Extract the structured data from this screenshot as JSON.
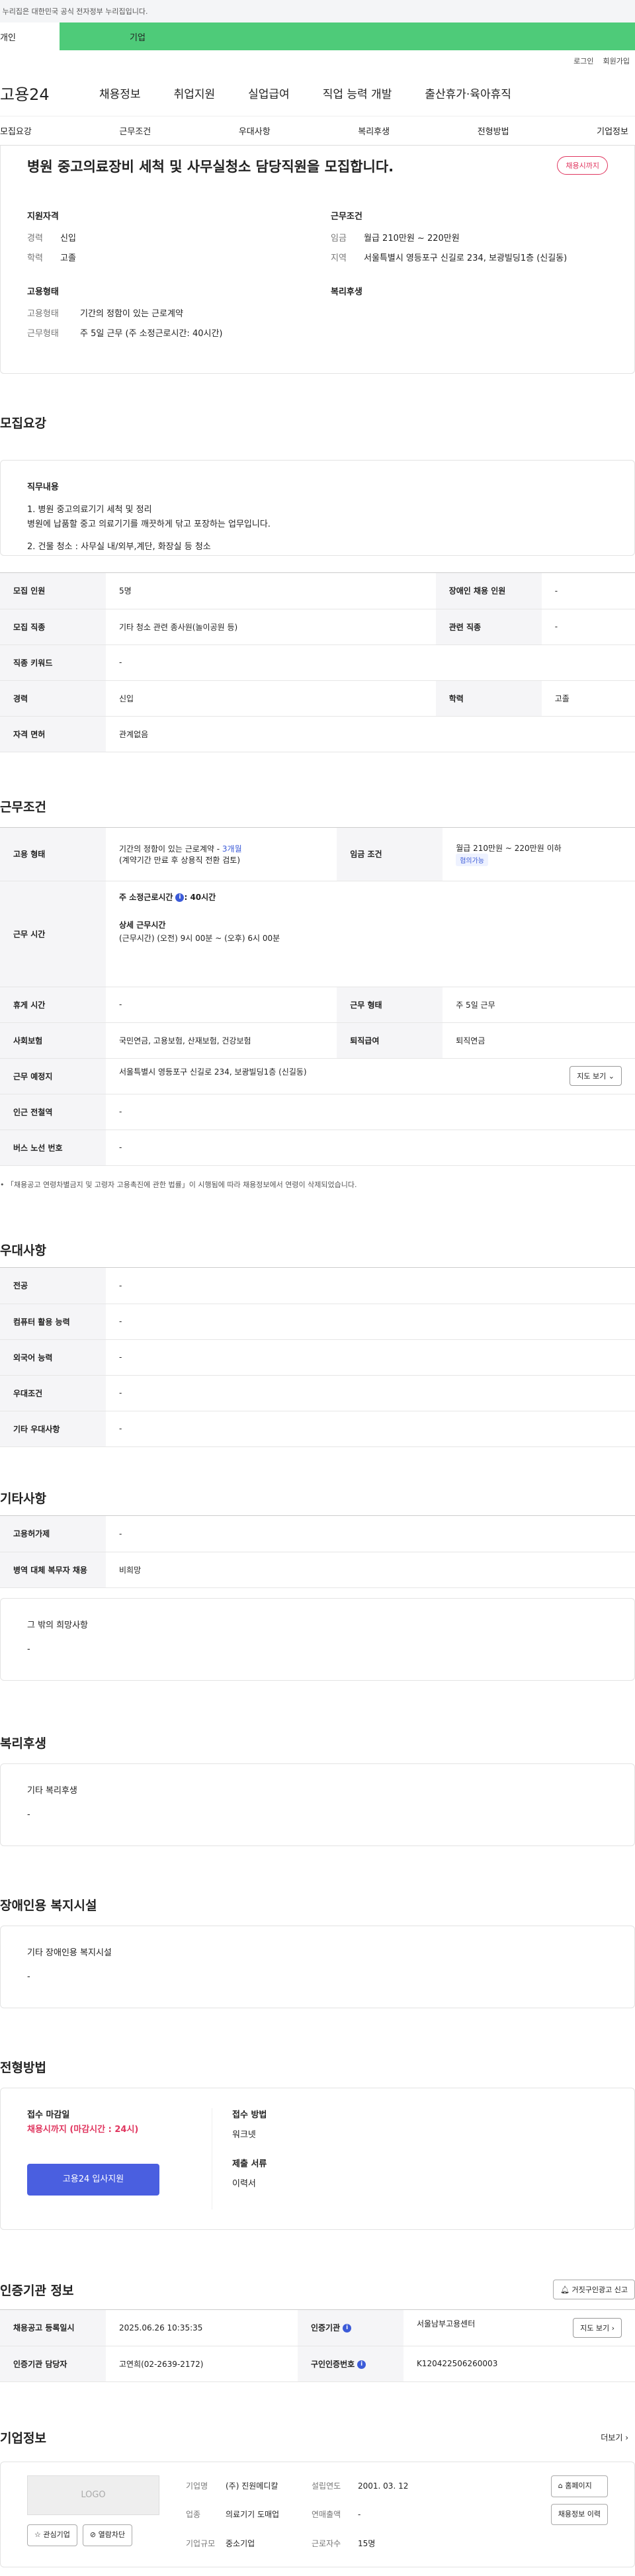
{
  "top": {
    "note": "이 누리집은 대한민국 공식 전자정부 누리집입니다.",
    "tab_personal": "개인",
    "tab_company": "기업",
    "login": "로그인",
    "signup": "회원가입"
  },
  "gnb": {
    "logo": "고용24",
    "items": [
      "채용정보",
      "취업지원",
      "실업급여",
      "직업 능력 개발",
      "출산휴가·육아휴직"
    ]
  },
  "subtabs": [
    "모집요강",
    "근무조건",
    "우대사항",
    "복리후생",
    "전형방법",
    "기업정보"
  ],
  "summary": {
    "title": "병원 중고의료장비 세척 및 사무실청소 담당직원을 모집합니다.",
    "badge": "채용시까지",
    "qual_heading": "지원자격",
    "career_k": "경력",
    "career_v": "신입",
    "edu_k": "학력",
    "edu_v": "고졸",
    "cond_heading": "근무조건",
    "wage_k": "임금",
    "wage_v": "월급 210만원 ~ 220만원",
    "area_k": "지역",
    "area_v": "서울특별시 영등포구 신길로 234, 보광빌딩1층 (신길동)",
    "emp_heading": "고용형태",
    "emptype_k": "고용형태",
    "emptype_v": "기간의 정함이 있는 근로계약",
    "worktype_k": "근무형태",
    "worktype_v": "주 5일 근무 (주 소정근로시간: 40시간)",
    "welfare_heading": "복리후생"
  },
  "recruit": {
    "title": "모집요강",
    "duty_heading": "직무내용",
    "duty_lines": [
      "1. 병원 중고의료기기 세척 및 정리",
      "병원에 납품할 중고 의료기기를 깨끗하게 닦고 포장하는 업무입니다.",
      "2. 건물 청소 : 사무실 내/외부,계단, 화장실 등 청소"
    ],
    "rows": [
      {
        "k1": "모집 인원",
        "v1": "5명",
        "k2": "장애인 채용 인원",
        "v2": "-"
      },
      {
        "k1": "모집 직종",
        "v1": "기타 청소 관련 종사원(놀이공원 등)",
        "k2": "관련 직종",
        "v2": "-"
      },
      {
        "k1": "직종 키워드",
        "v1": "-"
      },
      {
        "k1": "경력",
        "v1": "신입",
        "k2": "학력",
        "v2": "고졸"
      },
      {
        "k1": "자격 면허",
        "v1": "관계없음"
      }
    ]
  },
  "work": {
    "title": "근무조건",
    "emp_k": "고용 형태",
    "emp_v1": "기간의 정함이 있는 근로계약 - ",
    "emp_v1_link": "3개월",
    "emp_v2": "(계약기간 만료 후 상용직 전환 검토)",
    "wage_k": "임금 조건",
    "wage_v": "월급 210만원 ~ 220만원 이하",
    "wage_pill": "협의가능",
    "hours_k": "근무 시간",
    "hours_weekly": "주 소정근로시간",
    "hours_weekly_v": ": 40시간",
    "hours_detail_h": "상세 근무시간",
    "hours_detail_v": "(근무시간) (오전) 9시 00분 ~ (오후) 6시 00분",
    "rows": [
      {
        "k1": "휴게 시간",
        "v1": "-",
        "k2": "근무 형태",
        "v2": "주 5일 근무"
      },
      {
        "k1": "사회보험",
        "v1": "국민연금, 고용보험, 산재보험, 건강보험",
        "k2": "퇴직급여",
        "v2": "퇴직연금"
      }
    ],
    "place_k": "근무 예정지",
    "place_v": "서울특별시 영등포구 신길로 234, 보광빌딩1층 (신길동)",
    "map_btn": "지도 보기",
    "station_k": "인근 전철역",
    "station_v": "-",
    "bus_k": "버스 노선 번호",
    "bus_v": "-",
    "note": "「채용공고 연령차별금지 및 고령자 고용촉진에 관한 법률」이 시행됨에 따라 채용정보에서 연령이 삭제되었습니다."
  },
  "pref": {
    "title": "우대사항",
    "rows": [
      {
        "k": "전공",
        "v": "-"
      },
      {
        "k": "컴퓨터 활용 능력",
        "v": "-"
      },
      {
        "k": "외국어 능력",
        "v": "-"
      },
      {
        "k": "우대조건",
        "v": "-"
      },
      {
        "k": "기타 우대사항",
        "v": "-"
      }
    ]
  },
  "etc": {
    "title": "기타사항",
    "rows": [
      {
        "k": "고용허가제",
        "v": "-"
      },
      {
        "k": "병역 대체 복무자 채용",
        "v": "비희망"
      }
    ],
    "hope_h": "그 밖의 희망사항",
    "hope_v": "-"
  },
  "welfare": {
    "title": "복리후생",
    "h": "기타 복리후생",
    "v": "-"
  },
  "disab": {
    "title": "장애인용 복지시설",
    "h": "기타 장애인용 복지시설",
    "v": "-"
  },
  "selection": {
    "title": "전형방법",
    "deadline_h": "접수 마감일",
    "deadline_v": "채용시까지 (마감시간 : 24시)",
    "apply_btn": "고용24 입사지원",
    "method_h": "접수 방법",
    "method_v": "워크넷",
    "docs_h": "제출 서류",
    "docs_v": "이력서"
  },
  "cert": {
    "title": "인증기관 정보",
    "report_btn": "거짓구인광고 신고",
    "reg_k": "채용공고 등록일시",
    "reg_v": "2025.06.26 10:35:35",
    "org_k": "인증기관",
    "org_v": "서울남부고용센터",
    "map_btn": "지도 보기",
    "mgr_k": "인증기관 담당자",
    "mgr_v": "고연희(02-2639-2172)",
    "no_k": "구인인증번호",
    "no_v": "K120422506260003"
  },
  "company": {
    "title": "기업정보",
    "more": "더보기",
    "logo": "LOGO",
    "fav": "관심기업",
    "block": "열람차단",
    "name_k": "기업명",
    "name_v": "(주) 진원메디칼",
    "year_k": "설립연도",
    "year_v": "2001. 03. 12",
    "ind_k": "업종",
    "ind_v": "의료기기 도매업",
    "sales_k": "연매출액",
    "sales_v": "-",
    "size_k": "기업규모",
    "size_v": "중소기업",
    "emp_k": "근로자수",
    "emp_v": "15명",
    "home_btn": "홈페이지",
    "history_btn": "채용정보 이력"
  }
}
